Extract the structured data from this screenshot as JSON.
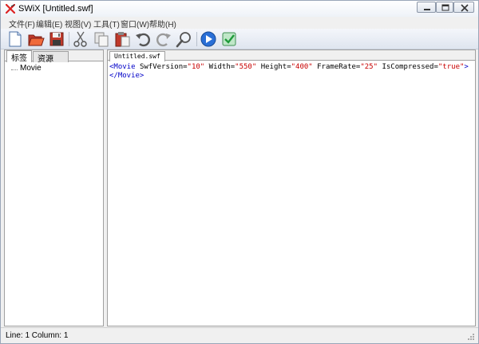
{
  "window": {
    "title": "SWiX [Untitled.swf]"
  },
  "menu": [
    "文件(F)",
    "编辑(E)",
    "视图(V)",
    "工具(T)",
    "窗口(W)",
    "帮助(H)"
  ],
  "toolbar": {
    "buttons": [
      "new-icon",
      "open-icon",
      "save-icon",
      "cut-icon",
      "copy-icon",
      "paste-icon",
      "undo-icon",
      "redo-icon",
      "find-icon",
      "play-icon",
      "validate-icon"
    ]
  },
  "left_panel": {
    "tabs": [
      "标签",
      "资源"
    ],
    "tree": [
      "Movie"
    ]
  },
  "editor": {
    "tab": "Untitled.swf",
    "line1": {
      "open": "<Movie",
      "a1": "SwfVersion=",
      "v1": "\"10\"",
      "a2": "Width=",
      "v2": "\"550\"",
      "a3": "Height=",
      "v3": "\"400\"",
      "a4": "FrameRate=",
      "v4": "\"25\"",
      "a5": "IsCompressed=",
      "v5": "\"true\"",
      "close": ">"
    },
    "line2": "</Movie>"
  },
  "status": {
    "text": "Line: 1 Column: 1"
  },
  "colors": {
    "tag": "#0000c8",
    "value": "#c80000",
    "accent": "#2a6fd6"
  }
}
